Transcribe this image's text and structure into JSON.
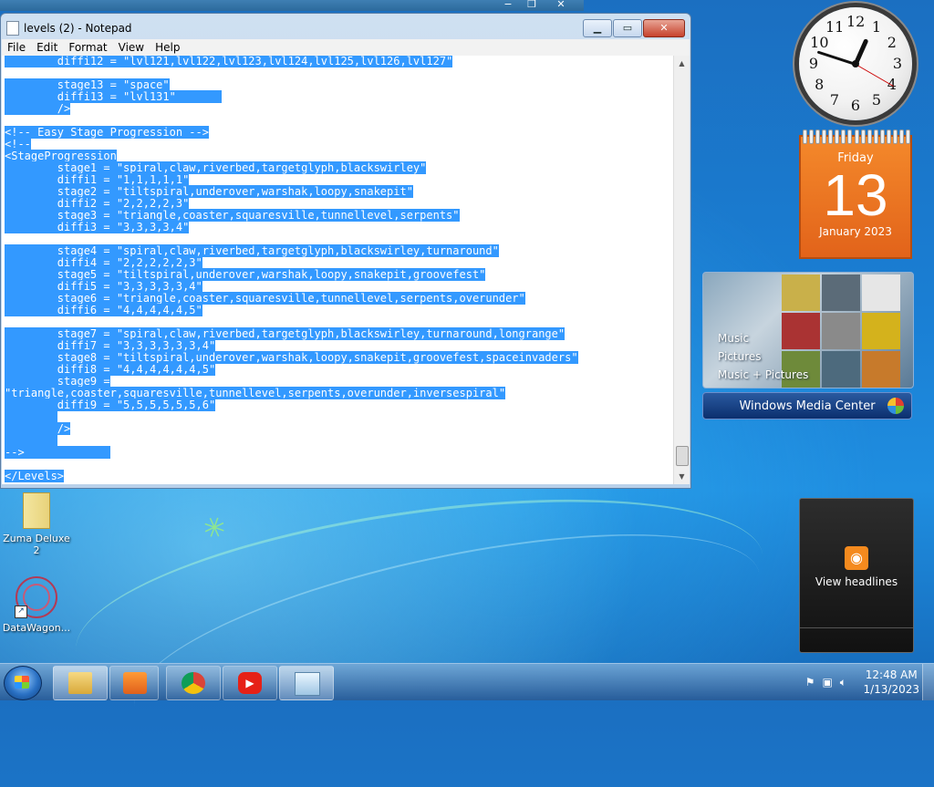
{
  "notepad": {
    "title": "levels (2) - Notepad",
    "menu": [
      "File",
      "Edit",
      "Format",
      "View",
      "Help"
    ],
    "lines": [
      "        diffi12 = \"lvl121,lvl122,lvl123,lvl124,lvl125,lvl126,lvl127\"",
      "",
      "        stage13 = \"space\"",
      "        diffi13 = \"lvl131\"       ",
      "        />",
      "",
      "<!-- Easy Stage Progression -->",
      "<!--",
      "<StageProgression",
      "        stage1 = \"spiral,claw,riverbed,targetglyph,blackswirley\"",
      "        diffi1 = \"1,1,1,1,1\"",
      "        stage2 = \"tiltspiral,underover,warshak,loopy,snakepit\"",
      "        diffi2 = \"2,2,2,2,3\"",
      "        stage3 = \"triangle,coaster,squaresville,tunnellevel,serpents\"",
      "        diffi3 = \"3,3,3,3,4\"",
      "",
      "        stage4 = \"spiral,claw,riverbed,targetglyph,blackswirley,turnaround\"",
      "        diffi4 = \"2,2,2,2,2,3\"",
      "        stage5 = \"tiltspiral,underover,warshak,loopy,snakepit,groovefest\"",
      "        diffi5 = \"3,3,3,3,3,4\"",
      "        stage6 = \"triangle,coaster,squaresville,tunnellevel,serpents,overunder\"",
      "        diffi6 = \"4,4,4,4,4,5\"",
      "",
      "        stage7 = \"spiral,claw,riverbed,targetglyph,blackswirley,turnaround,longrange\"",
      "        diffi7 = \"3,3,3,3,3,3,4\"",
      "        stage8 = \"tiltspiral,underover,warshak,loopy,snakepit,groovefest,spaceinvaders\"",
      "        diffi8 = \"4,4,4,4,4,4,5\"",
      "        stage9 =",
      "\"triangle,coaster,squaresville,tunnellevel,serpents,overunder,inversespiral\"",
      "        diffi9 = \"5,5,5,5,5,5,6\"",
      "        ",
      "        />",
      "        ",
      "-->             ",
      "",
      "</Levels>"
    ]
  },
  "desktop_icons": [
    {
      "label": "Zuma Deluxe 2",
      "icon": "zip-folder-icon"
    },
    {
      "label": "DataWagon...",
      "icon": "datawagon-icon"
    }
  ],
  "clock": {
    "hour": 12,
    "minute": 48,
    "second": 20
  },
  "calendar": {
    "day_of_week": "Friday",
    "day": "13",
    "month_year": "January 2023"
  },
  "media_center": {
    "items": [
      "Music",
      "Pictures",
      "Music + Pictures"
    ],
    "bar_label": "Windows Media Center"
  },
  "rss": {
    "label": "View headlines"
  },
  "taskbar": {
    "buttons": [
      "windows-explorer",
      "media-player",
      "chrome",
      "youtube",
      "notepad"
    ],
    "time": "12:48 AM",
    "date": "1/13/2023"
  },
  "colors": {
    "selection": "#3399ff",
    "calendar": "#ec7421",
    "taskbar": "#3a76b0"
  }
}
